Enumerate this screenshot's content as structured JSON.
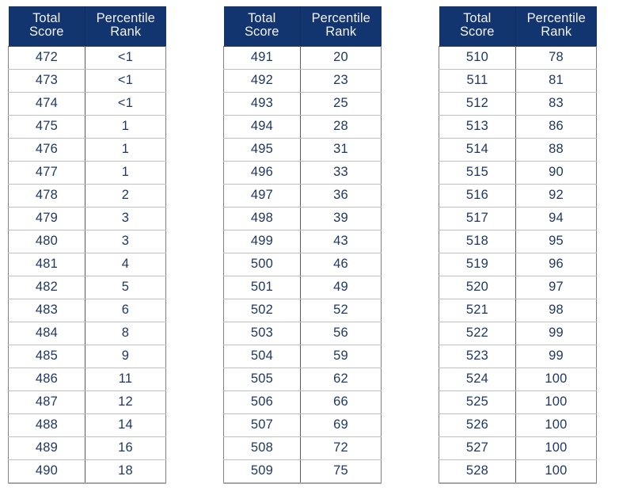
{
  "document": {
    "type": "score-percentile-conversion-tables",
    "table_count": 3
  },
  "colors": {
    "header_background": "#12356F",
    "header_text": "#F2F2F2",
    "body_text": "#1F3864",
    "grid_line": "#BFBFBF",
    "outer_border": "#808080",
    "page_background": "#FFFFFF"
  },
  "columns": {
    "score_line1": "Total",
    "score_line2": "Score",
    "rank_line1": "Percentile",
    "rank_line2": "Rank"
  },
  "tables": [
    {
      "id": "table-1",
      "rows": [
        {
          "score": "472",
          "rank": "<1"
        },
        {
          "score": "473",
          "rank": "<1"
        },
        {
          "score": "474",
          "rank": "<1"
        },
        {
          "score": "475",
          "rank": "1"
        },
        {
          "score": "476",
          "rank": "1"
        },
        {
          "score": "477",
          "rank": "1"
        },
        {
          "score": "478",
          "rank": "2"
        },
        {
          "score": "479",
          "rank": "3"
        },
        {
          "score": "480",
          "rank": "3"
        },
        {
          "score": "481",
          "rank": "4"
        },
        {
          "score": "482",
          "rank": "5"
        },
        {
          "score": "483",
          "rank": "6"
        },
        {
          "score": "484",
          "rank": "8"
        },
        {
          "score": "485",
          "rank": "9"
        },
        {
          "score": "486",
          "rank": "11"
        },
        {
          "score": "487",
          "rank": "12"
        },
        {
          "score": "488",
          "rank": "14"
        },
        {
          "score": "489",
          "rank": "16"
        },
        {
          "score": "490",
          "rank": "18"
        }
      ]
    },
    {
      "id": "table-2",
      "rows": [
        {
          "score": "491",
          "rank": "20"
        },
        {
          "score": "492",
          "rank": "23"
        },
        {
          "score": "493",
          "rank": "25"
        },
        {
          "score": "494",
          "rank": "28"
        },
        {
          "score": "495",
          "rank": "31"
        },
        {
          "score": "496",
          "rank": "33"
        },
        {
          "score": "497",
          "rank": "36"
        },
        {
          "score": "498",
          "rank": "39"
        },
        {
          "score": "499",
          "rank": "43"
        },
        {
          "score": "500",
          "rank": "46"
        },
        {
          "score": "501",
          "rank": "49"
        },
        {
          "score": "502",
          "rank": "52"
        },
        {
          "score": "503",
          "rank": "56"
        },
        {
          "score": "504",
          "rank": "59"
        },
        {
          "score": "505",
          "rank": "62"
        },
        {
          "score": "506",
          "rank": "66"
        },
        {
          "score": "507",
          "rank": "69"
        },
        {
          "score": "508",
          "rank": "72"
        },
        {
          "score": "509",
          "rank": "75"
        }
      ]
    },
    {
      "id": "table-3",
      "rows": [
        {
          "score": "510",
          "rank": "78"
        },
        {
          "score": "511",
          "rank": "81"
        },
        {
          "score": "512",
          "rank": "83"
        },
        {
          "score": "513",
          "rank": "86"
        },
        {
          "score": "514",
          "rank": "88"
        },
        {
          "score": "515",
          "rank": "90"
        },
        {
          "score": "516",
          "rank": "92"
        },
        {
          "score": "517",
          "rank": "94"
        },
        {
          "score": "518",
          "rank": "95"
        },
        {
          "score": "519",
          "rank": "96"
        },
        {
          "score": "520",
          "rank": "97"
        },
        {
          "score": "521",
          "rank": "98"
        },
        {
          "score": "522",
          "rank": "99"
        },
        {
          "score": "523",
          "rank": "99"
        },
        {
          "score": "524",
          "rank": "100"
        },
        {
          "score": "525",
          "rank": "100"
        },
        {
          "score": "526",
          "rank": "100"
        },
        {
          "score": "527",
          "rank": "100"
        },
        {
          "score": "528",
          "rank": "100"
        }
      ]
    }
  ],
  "chart_data": {
    "type": "table",
    "title": "",
    "xlabel": "Total Score",
    "ylabel": "Percentile Rank",
    "categories": [
      "472",
      "473",
      "474",
      "475",
      "476",
      "477",
      "478",
      "479",
      "480",
      "481",
      "482",
      "483",
      "484",
      "485",
      "486",
      "487",
      "488",
      "489",
      "490",
      "491",
      "492",
      "493",
      "494",
      "495",
      "496",
      "497",
      "498",
      "499",
      "500",
      "501",
      "502",
      "503",
      "504",
      "505",
      "506",
      "507",
      "508",
      "509",
      "510",
      "511",
      "512",
      "513",
      "514",
      "515",
      "516",
      "517",
      "518",
      "519",
      "520",
      "521",
      "522",
      "523",
      "524",
      "525",
      "526",
      "527",
      "528"
    ],
    "values": [
      "<1",
      "<1",
      "<1",
      1,
      1,
      1,
      2,
      3,
      3,
      4,
      5,
      6,
      8,
      9,
      11,
      12,
      14,
      16,
      18,
      20,
      23,
      25,
      28,
      31,
      33,
      36,
      39,
      43,
      46,
      49,
      52,
      56,
      59,
      62,
      66,
      69,
      72,
      75,
      78,
      81,
      83,
      86,
      88,
      90,
      92,
      94,
      95,
      96,
      97,
      98,
      99,
      99,
      100,
      100,
      100,
      100,
      100
    ]
  }
}
